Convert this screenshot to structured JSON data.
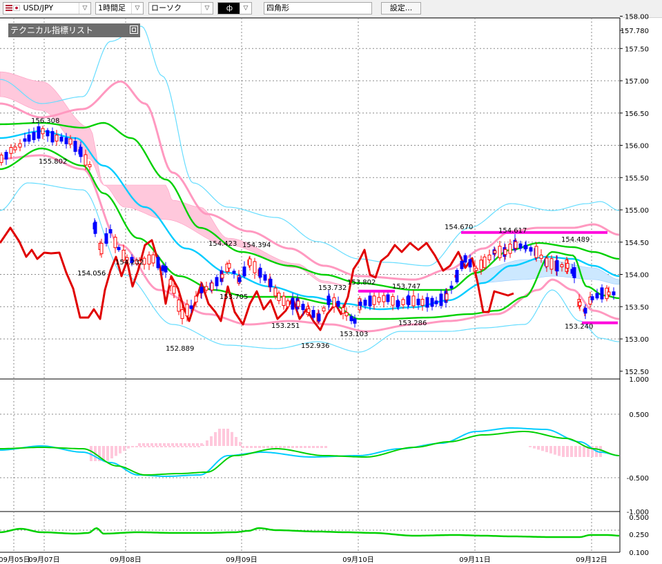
{
  "toolbar": {
    "symbol": "USD/JPY",
    "timeframe": "1時間足",
    "chart_style": "ローソク",
    "draw_tool": "ф",
    "shape": "四角形",
    "settings": "設定..."
  },
  "indicator_list": {
    "title": "テクニカル指標リスト"
  },
  "colors": {
    "bullish": "#ff0000",
    "bearish": "#0000ff",
    "bollinger_mid": "#00d000",
    "bollinger_inner": "#ff99c0",
    "bollinger_outer": "#66ddff",
    "ema": "#00ccff",
    "oscillator_red": "#e00000",
    "marker": "#ff00dd",
    "cloud_pink": "#ffc8dc",
    "cloud_blue": "#cce8ff"
  },
  "chart_data": [
    {
      "type": "candlestick",
      "price_axis": [
        "158.00",
        "157.780",
        "157.50",
        "157.00",
        "156.50",
        "156.00",
        "155.50",
        "155.00",
        "154.50",
        "154.00",
        "153.50",
        "153.00",
        "152.50"
      ],
      "ylim": [
        152.5,
        158.0
      ],
      "date_axis": [
        "09月05日",
        "09月07日",
        "09月08日",
        "09月09日",
        "09月10日",
        "09月11日",
        "09月12日"
      ],
      "annotations": [
        "156.308",
        "155.802",
        "154.056",
        "154.232",
        "152.889",
        "154.423",
        "153.705",
        "154.394",
        "153.251",
        "152.936",
        "153.732",
        "153.103",
        "153.802",
        "153.747",
        "153.286",
        "154.670",
        "154.617",
        "154.489",
        "153.240"
      ],
      "markers": [
        {
          "price": 153.74,
          "from": "09月10日",
          "kind": "resistance"
        },
        {
          "price": 154.65,
          "from": "09月11日",
          "kind": "resistance"
        },
        {
          "price": 153.25,
          "from": "09月12日",
          "kind": "support"
        }
      ]
    },
    {
      "type": "line",
      "name": "",
      "axis": [
        "1.000",
        "0.500",
        "-0.500",
        "-1.000"
      ],
      "ylim": [
        -1.0,
        1.0
      ]
    },
    {
      "type": "line",
      "name": "",
      "axis": [
        "0.500",
        "0.250",
        "0.100"
      ],
      "ylim": [
        0.1,
        0.5
      ]
    }
  ]
}
